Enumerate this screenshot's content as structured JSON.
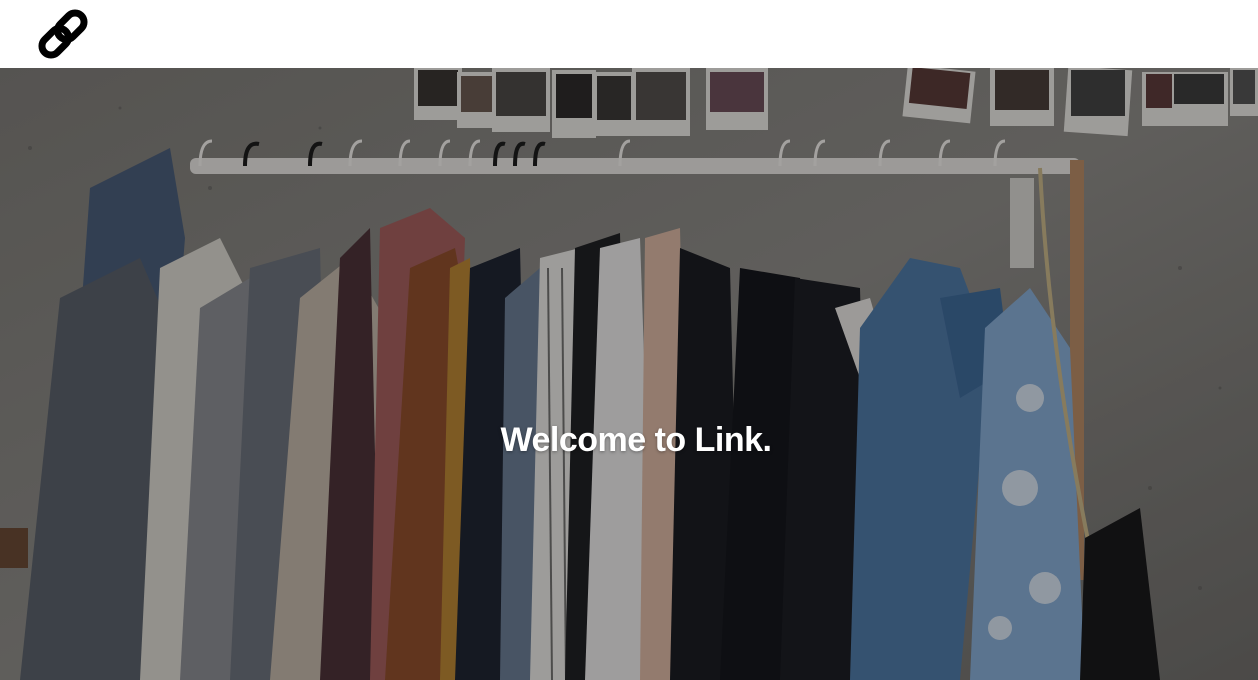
{
  "header": {
    "logo_icon": "chain-link-icon"
  },
  "hero": {
    "title": "Welcome to Link.",
    "image": "clothing-rack-photo"
  },
  "colors": {
    "header_bg": "#ffffff",
    "hero_text": "#ffffff",
    "wall": "#8a8884"
  }
}
